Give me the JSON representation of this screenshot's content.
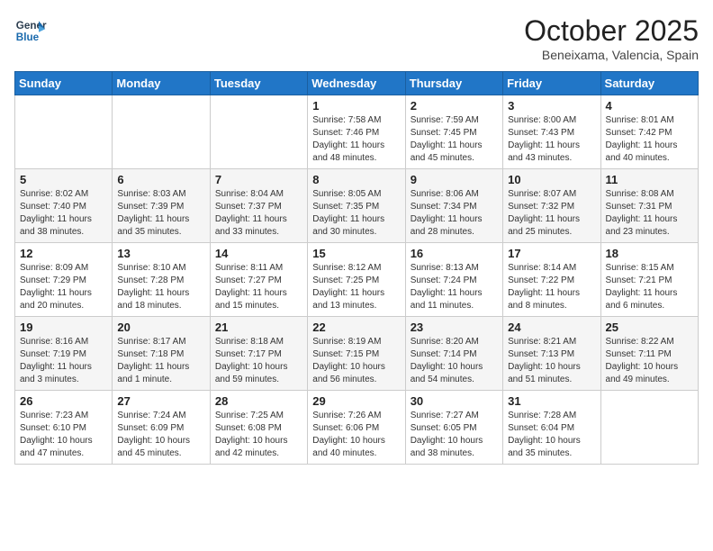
{
  "header": {
    "logo_line1": "General",
    "logo_line2": "Blue",
    "month": "October 2025",
    "location": "Beneixama, Valencia, Spain"
  },
  "weekdays": [
    "Sunday",
    "Monday",
    "Tuesday",
    "Wednesday",
    "Thursday",
    "Friday",
    "Saturday"
  ],
  "weeks": [
    [
      {
        "day": "",
        "info": ""
      },
      {
        "day": "",
        "info": ""
      },
      {
        "day": "",
        "info": ""
      },
      {
        "day": "1",
        "info": "Sunrise: 7:58 AM\nSunset: 7:46 PM\nDaylight: 11 hours\nand 48 minutes."
      },
      {
        "day": "2",
        "info": "Sunrise: 7:59 AM\nSunset: 7:45 PM\nDaylight: 11 hours\nand 45 minutes."
      },
      {
        "day": "3",
        "info": "Sunrise: 8:00 AM\nSunset: 7:43 PM\nDaylight: 11 hours\nand 43 minutes."
      },
      {
        "day": "4",
        "info": "Sunrise: 8:01 AM\nSunset: 7:42 PM\nDaylight: 11 hours\nand 40 minutes."
      }
    ],
    [
      {
        "day": "5",
        "info": "Sunrise: 8:02 AM\nSunset: 7:40 PM\nDaylight: 11 hours\nand 38 minutes."
      },
      {
        "day": "6",
        "info": "Sunrise: 8:03 AM\nSunset: 7:39 PM\nDaylight: 11 hours\nand 35 minutes."
      },
      {
        "day": "7",
        "info": "Sunrise: 8:04 AM\nSunset: 7:37 PM\nDaylight: 11 hours\nand 33 minutes."
      },
      {
        "day": "8",
        "info": "Sunrise: 8:05 AM\nSunset: 7:35 PM\nDaylight: 11 hours\nand 30 minutes."
      },
      {
        "day": "9",
        "info": "Sunrise: 8:06 AM\nSunset: 7:34 PM\nDaylight: 11 hours\nand 28 minutes."
      },
      {
        "day": "10",
        "info": "Sunrise: 8:07 AM\nSunset: 7:32 PM\nDaylight: 11 hours\nand 25 minutes."
      },
      {
        "day": "11",
        "info": "Sunrise: 8:08 AM\nSunset: 7:31 PM\nDaylight: 11 hours\nand 23 minutes."
      }
    ],
    [
      {
        "day": "12",
        "info": "Sunrise: 8:09 AM\nSunset: 7:29 PM\nDaylight: 11 hours\nand 20 minutes."
      },
      {
        "day": "13",
        "info": "Sunrise: 8:10 AM\nSunset: 7:28 PM\nDaylight: 11 hours\nand 18 minutes."
      },
      {
        "day": "14",
        "info": "Sunrise: 8:11 AM\nSunset: 7:27 PM\nDaylight: 11 hours\nand 15 minutes."
      },
      {
        "day": "15",
        "info": "Sunrise: 8:12 AM\nSunset: 7:25 PM\nDaylight: 11 hours\nand 13 minutes."
      },
      {
        "day": "16",
        "info": "Sunrise: 8:13 AM\nSunset: 7:24 PM\nDaylight: 11 hours\nand 11 minutes."
      },
      {
        "day": "17",
        "info": "Sunrise: 8:14 AM\nSunset: 7:22 PM\nDaylight: 11 hours\nand 8 minutes."
      },
      {
        "day": "18",
        "info": "Sunrise: 8:15 AM\nSunset: 7:21 PM\nDaylight: 11 hours\nand 6 minutes."
      }
    ],
    [
      {
        "day": "19",
        "info": "Sunrise: 8:16 AM\nSunset: 7:19 PM\nDaylight: 11 hours\nand 3 minutes."
      },
      {
        "day": "20",
        "info": "Sunrise: 8:17 AM\nSunset: 7:18 PM\nDaylight: 11 hours\nand 1 minute."
      },
      {
        "day": "21",
        "info": "Sunrise: 8:18 AM\nSunset: 7:17 PM\nDaylight: 10 hours\nand 59 minutes."
      },
      {
        "day": "22",
        "info": "Sunrise: 8:19 AM\nSunset: 7:15 PM\nDaylight: 10 hours\nand 56 minutes."
      },
      {
        "day": "23",
        "info": "Sunrise: 8:20 AM\nSunset: 7:14 PM\nDaylight: 10 hours\nand 54 minutes."
      },
      {
        "day": "24",
        "info": "Sunrise: 8:21 AM\nSunset: 7:13 PM\nDaylight: 10 hours\nand 51 minutes."
      },
      {
        "day": "25",
        "info": "Sunrise: 8:22 AM\nSunset: 7:11 PM\nDaylight: 10 hours\nand 49 minutes."
      }
    ],
    [
      {
        "day": "26",
        "info": "Sunrise: 7:23 AM\nSunset: 6:10 PM\nDaylight: 10 hours\nand 47 minutes."
      },
      {
        "day": "27",
        "info": "Sunrise: 7:24 AM\nSunset: 6:09 PM\nDaylight: 10 hours\nand 45 minutes."
      },
      {
        "day": "28",
        "info": "Sunrise: 7:25 AM\nSunset: 6:08 PM\nDaylight: 10 hours\nand 42 minutes."
      },
      {
        "day": "29",
        "info": "Sunrise: 7:26 AM\nSunset: 6:06 PM\nDaylight: 10 hours\nand 40 minutes."
      },
      {
        "day": "30",
        "info": "Sunrise: 7:27 AM\nSunset: 6:05 PM\nDaylight: 10 hours\nand 38 minutes."
      },
      {
        "day": "31",
        "info": "Sunrise: 7:28 AM\nSunset: 6:04 PM\nDaylight: 10 hours\nand 35 minutes."
      },
      {
        "day": "",
        "info": ""
      }
    ]
  ]
}
